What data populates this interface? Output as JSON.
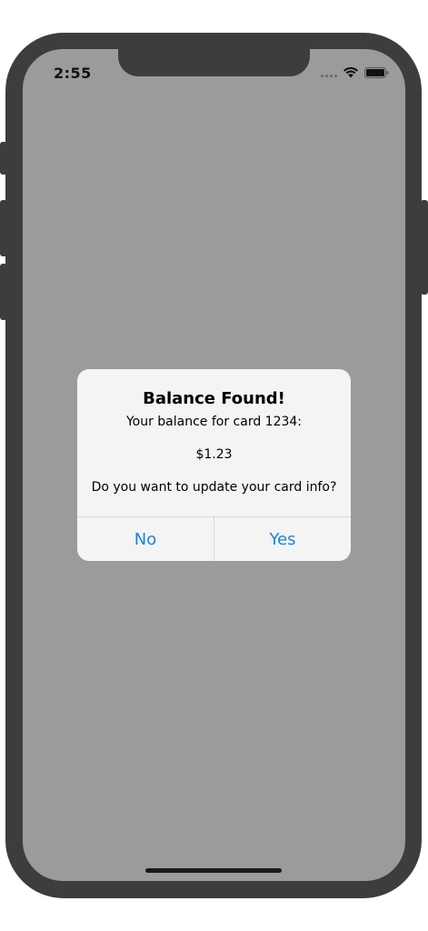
{
  "status_bar": {
    "time": "2:55",
    "icons": [
      "cellular-dots-icon",
      "wifi-icon",
      "battery-icon"
    ]
  },
  "alert": {
    "title": "Balance Found!",
    "line1": "Your balance for card 1234:",
    "line2": "$1.23",
    "line3": "Do you want to update your card info?",
    "buttons": {
      "no": "No",
      "yes": "Yes"
    }
  },
  "colors": {
    "device_frame": "#3d3d3d",
    "screen_dimmed": "#9b9b9b",
    "alert_background": "#f4f4f4",
    "button_text": "#1a82e2"
  }
}
